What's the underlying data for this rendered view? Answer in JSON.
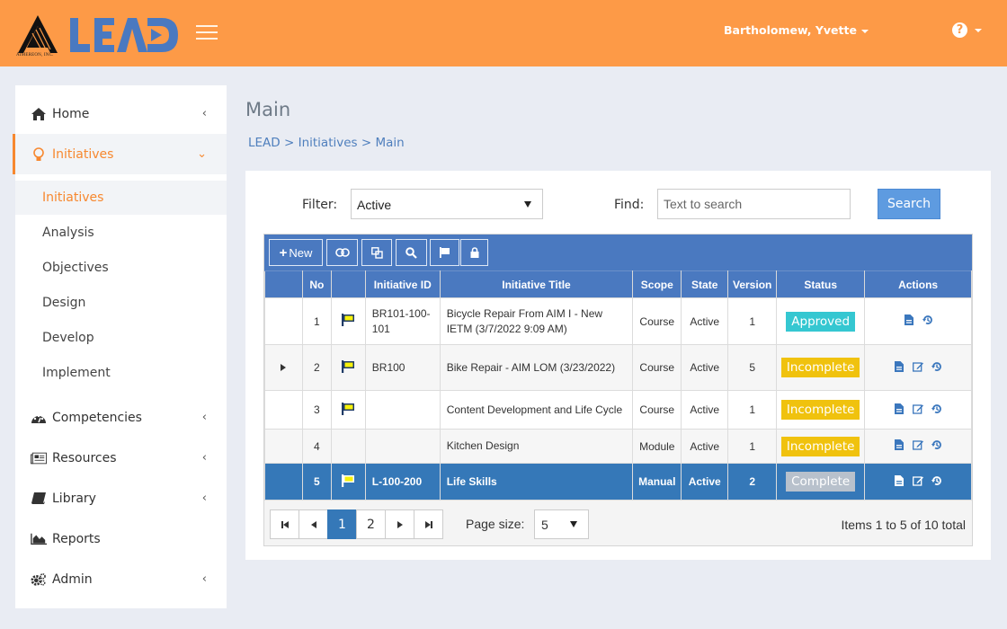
{
  "header": {
    "brand": "LEAD",
    "company": "AIMEREON, INC.",
    "user_name": "Bartholomew, Yvette",
    "help_icon": "question-circle-icon",
    "colors": {
      "bar": "#fd9a47",
      "brand_blue": "#4a79c0",
      "accent": "#f7882f"
    }
  },
  "sidebar": {
    "items": [
      {
        "label": "Home",
        "icon": "home-icon",
        "chevron": "‹"
      },
      {
        "label": "Initiatives",
        "icon": "lightbulb-icon",
        "chevron": "⌄",
        "active": true
      },
      {
        "label": "Competencies",
        "icon": "dashboard-icon",
        "chevron": "‹"
      },
      {
        "label": "Resources",
        "icon": "newspaper-icon",
        "chevron": "‹"
      },
      {
        "label": "Library",
        "icon": "book-icon",
        "chevron": "‹"
      },
      {
        "label": "Reports",
        "icon": "area-chart-icon",
        "chevron": ""
      },
      {
        "label": "Admin",
        "icon": "gears-icon",
        "chevron": "‹"
      }
    ],
    "subitems": [
      {
        "label": "Initiatives",
        "active": true
      },
      {
        "label": "Analysis"
      },
      {
        "label": "Objectives"
      },
      {
        "label": "Design"
      },
      {
        "label": "Develop"
      },
      {
        "label": "Implement"
      }
    ]
  },
  "main": {
    "title": "Main",
    "breadcrumb": [
      "LEAD",
      "Initiatives",
      "Main"
    ],
    "breadcrumb_sep": " > ",
    "filter": {
      "label": "Filter:",
      "value": "Active"
    },
    "find": {
      "label": "Find:",
      "placeholder": "Text to search",
      "value": ""
    },
    "search_label": "Search"
  },
  "grid": {
    "toolbar": {
      "new_label": "New",
      "buttons": [
        "new-icon",
        "toggle-icon",
        "copy-icon",
        "search-icon",
        "flag-icon",
        "lock-icon"
      ]
    },
    "columns": [
      "",
      "No",
      "",
      "Initiative ID",
      "Initiative Title",
      "Scope",
      "State",
      "Version",
      "Status",
      "Actions"
    ],
    "rows": [
      {
        "no": "1",
        "flag": true,
        "id": "BR101-100-101",
        "title": "Bicycle Repair From AIM I - New IETM (3/7/2022 9:09 AM)",
        "scope": "Course",
        "state": "Active",
        "version": "1",
        "status": "Approved",
        "actions": [
          "view",
          "history"
        ]
      },
      {
        "no": "2",
        "flag": true,
        "id": "BR100",
        "title": "Bike Repair - AIM LOM (3/23/2022)",
        "scope": "Course",
        "state": "Active",
        "version": "5",
        "status": "Incomplete",
        "actions": [
          "view",
          "edit",
          "history"
        ],
        "expandable": true
      },
      {
        "no": "3",
        "flag": true,
        "id": "",
        "title": "Content Development and Life Cycle",
        "scope": "Course",
        "state": "Active",
        "version": "1",
        "status": "Incomplete",
        "actions": [
          "view",
          "edit",
          "history"
        ]
      },
      {
        "no": "4",
        "flag": false,
        "id": "",
        "title": "Kitchen Design",
        "scope": "Module",
        "state": "Active",
        "version": "1",
        "status": "Incomplete",
        "actions": [
          "view",
          "edit",
          "history"
        ]
      },
      {
        "no": "5",
        "flag": true,
        "id": "L-100-200",
        "title": "Life Skills",
        "scope": "Manual",
        "state": "Active",
        "version": "2",
        "status": "Complete",
        "actions": [
          "view",
          "edit",
          "history"
        ],
        "selected": true
      }
    ],
    "status_colors": {
      "Approved": "#35c7d1",
      "Incomplete": "#f0c20e",
      "Complete": "#b8c1cc"
    },
    "pager": {
      "pages": [
        "1",
        "2"
      ],
      "current": "1",
      "page_size_label": "Page size:",
      "page_size": "5",
      "items_info": "Items 1 to 5 of 10 total"
    }
  }
}
